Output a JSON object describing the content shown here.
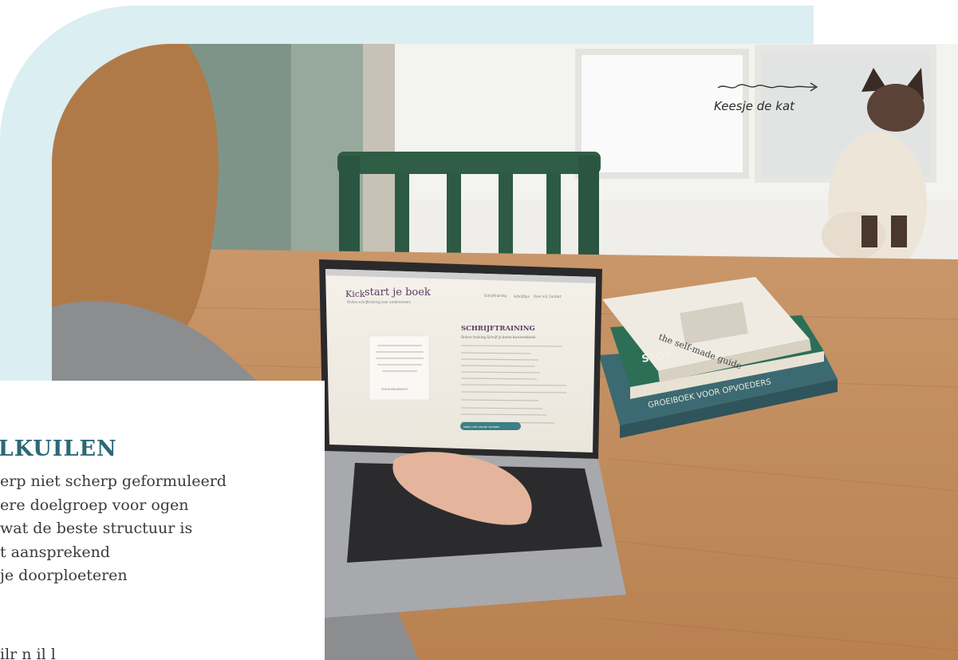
{
  "photo": {
    "cat_label": "Keesje de kat"
  },
  "screen_site": {
    "logo_kick": "Kick",
    "logo_rest": "start je boek",
    "logo_tagline": "Online schrijftraining voor ondernemers",
    "nav": [
      "Schrijftraining",
      "Schrijftips",
      "Over mij",
      "Contact"
    ],
    "section_title": "SCHRIJFTRAINING",
    "section_subtitle": "Online training Schrijf je beste businessboek",
    "quote_button": "STUUR EEN BERICHT",
    "cta_button": "MEER OVER ONLINE TRAINING"
  },
  "books": {
    "top_title": "the self-made guide",
    "middle_spine": "STOP",
    "bottom_spine": "GROEIBOEK VOOR OPVOEDERS"
  },
  "card": {
    "title": "VALKUILEN",
    "items": [
      "erp niet scherp geformuleerd",
      "ere doelgroep voor ogen",
      " wat de beste structuur is",
      "t aansprekend",
      "je doorploeteren"
    ],
    "cut_line": "ilr n   il   l"
  }
}
